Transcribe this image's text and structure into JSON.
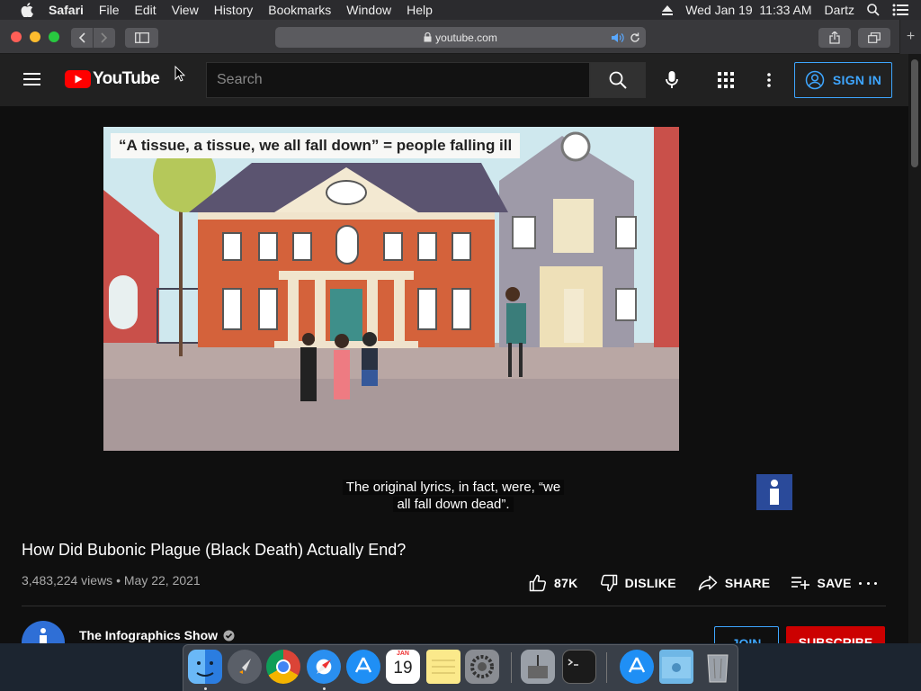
{
  "menubar": {
    "app": "Safari",
    "items": [
      "File",
      "Edit",
      "View",
      "History",
      "Bookmarks",
      "Window",
      "Help"
    ],
    "clock": "Wed Jan 19  11:33 AM",
    "user": "Dartz"
  },
  "browser": {
    "url": "youtube.com"
  },
  "header": {
    "logo_text": "YouTube",
    "search_placeholder": "Search",
    "sign_in": "SIGN IN"
  },
  "video": {
    "frame_caption": "“A tissue, a tissue, we all fall down” = people falling ill",
    "subtitle_line1": "The original lyrics, in fact, were, “we",
    "subtitle_line2": "all fall down dead”.",
    "title": "How Did Bubonic Plague (Black Death) Actually End?",
    "views": "3,483,224 views",
    "date": "May 22, 2021",
    "meta_separator": "•",
    "likes": "87K",
    "dislike": "DISLIKE",
    "share": "SHARE",
    "save": "SAVE"
  },
  "channel": {
    "name": "The Infographics Show",
    "join": "JOIN",
    "subscribe": "SUBSCRIBE"
  },
  "dock": {
    "calendar_month": "JAN",
    "calendar_day": "19"
  },
  "colors": {
    "youtube_red": "#ff0000",
    "link_blue": "#3ea6ff",
    "subscribe_red": "#cc0000",
    "page_bg": "#0f0f0f"
  }
}
